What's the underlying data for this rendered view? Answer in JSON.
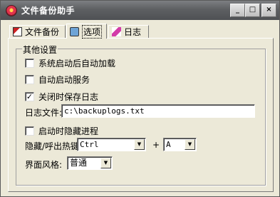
{
  "window": {
    "title": "文件备份助手"
  },
  "titlebar_buttons": {
    "minimize": "_",
    "maximize": "□",
    "close": "×"
  },
  "tabs": [
    {
      "label": "文件备份",
      "icon": "file-icon",
      "active": false
    },
    {
      "label": "选项",
      "icon": "options-icon",
      "active": true
    },
    {
      "label": "日志",
      "icon": "log-icon",
      "active": false
    }
  ],
  "options": {
    "group_label": "其他设置",
    "checkboxes": [
      {
        "label": "系统启动后自动加载",
        "checked": false
      },
      {
        "label": "自动启动服务",
        "checked": false
      },
      {
        "label": "关闭时保存日志",
        "checked": true
      },
      {
        "label": "启动时隐藏进程",
        "checked": false
      }
    ],
    "checkmark": "✓",
    "log_file_label": "日志文件:",
    "log_file_value": "c:\\backuplogs.txt",
    "hotkey_label": "隐藏/呼出热键",
    "hotkey_modifier": "Ctrl",
    "plus": "+",
    "hotkey_key": "A",
    "style_label": "界面风格:",
    "style_value": "普通",
    "dropdown_arrow": "▼"
  }
}
